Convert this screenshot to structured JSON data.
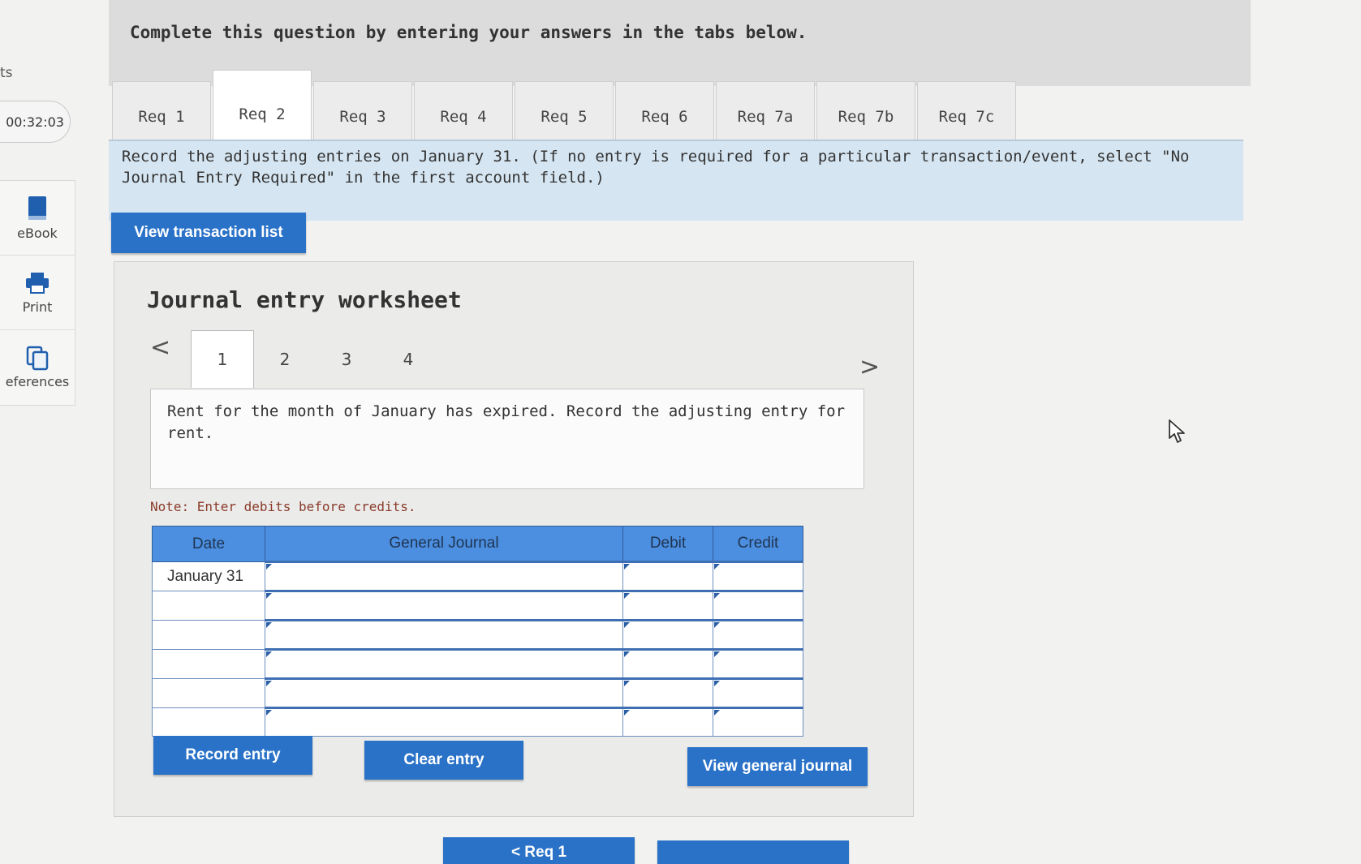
{
  "sidebar": {
    "partial_label": "ts",
    "timer": "00:32:03",
    "tools": [
      {
        "label": "eBook",
        "icon": "book-icon"
      },
      {
        "label": "Print",
        "icon": "printer-icon"
      },
      {
        "label": "eferences",
        "icon": "copy-icon"
      }
    ]
  },
  "header": {
    "instruction": "Complete this question by entering your answers in the tabs below."
  },
  "req_tabs": [
    "Req 1",
    "Req 2",
    "Req 3",
    "Req 4",
    "Req 5",
    "Req 6",
    "Req 7a",
    "Req 7b",
    "Req 7c"
  ],
  "active_req_tab": "Req 2",
  "instruction_text": "Record the adjusting entries on January 31. (If no entry is required for a particular transaction/event, select \"No Journal Entry Required\" in the first account field.)",
  "view_transaction_list_label": "View transaction list",
  "worksheet": {
    "title": "Journal entry worksheet",
    "tabs": [
      "1",
      "2",
      "3",
      "4"
    ],
    "active_tab": "1",
    "prev_glyph": "<",
    "next_glyph": ">",
    "description": "Rent for the month of January has expired. Record the adjusting entry for rent.",
    "note": "Note: Enter debits before credits.",
    "table": {
      "headers": [
        "Date",
        "General Journal",
        "Debit",
        "Credit"
      ],
      "rows": [
        {
          "date": "January 31"
        },
        {
          "date": ""
        },
        {
          "date": ""
        },
        {
          "date": ""
        },
        {
          "date": ""
        },
        {
          "date": ""
        }
      ]
    },
    "record_entry_label": "Record entry",
    "clear_entry_label": "Clear entry",
    "view_general_journal_label": "View general journal"
  },
  "bottom_nav": {
    "prev_label": "< Req 1",
    "next_label": ""
  }
}
